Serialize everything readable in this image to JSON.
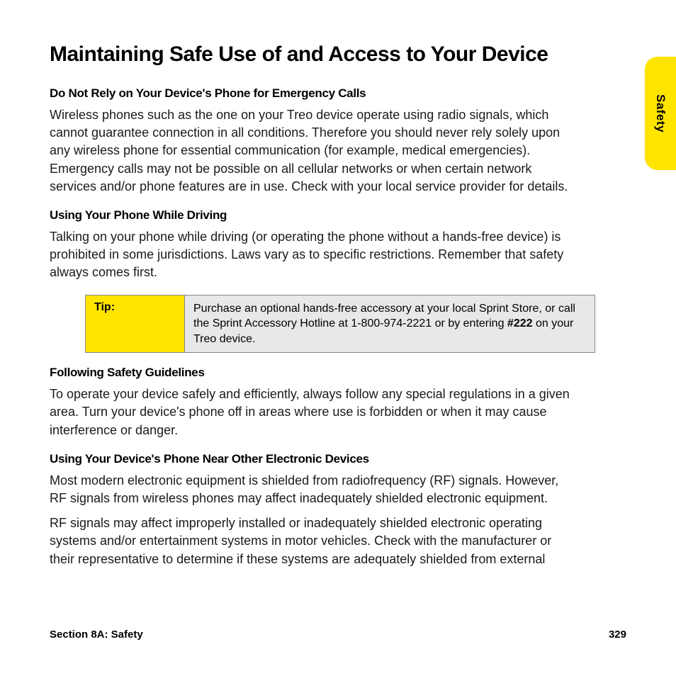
{
  "sideTab": "Safety",
  "title": "Maintaining Safe Use of and Access to Your Device",
  "sections": {
    "s1h": "Do Not Rely on Your Device's Phone for Emergency Calls",
    "s1p": "Wireless phones such as the one on your Treo device operate using radio signals, which cannot guarantee connection in all conditions. Therefore you should never rely solely upon any wireless phone for essential communication (for example, medical emergencies). Emergency calls may not be possible on all cellular networks or when certain network services and/or phone features are in use. Check with your local service provider for details.",
    "s2h": "Using Your Phone While Driving",
    "s2p": "Talking on your phone while driving (or operating the phone without a hands-free device) is prohibited in some jurisdictions. Laws vary as to specific restrictions. Remember that safety always comes first.",
    "s3h": "Following Safety Guidelines",
    "s3p": "To operate your device safely and efficiently, always follow any special regulations in a given area. Turn your device's phone off in areas where use is forbidden or when it may cause interference or danger.",
    "s4h": "Using Your Device's Phone Near Other Electronic Devices",
    "s4p1": "Most modern electronic equipment is shielded from radiofrequency (RF) signals. However, RF signals from wireless phones may affect inadequately shielded electronic equipment.",
    "s4p2": "RF signals may affect improperly installed or inadequately shielded electronic operating systems and/or entertainment systems in motor vehicles. Check with the manufacturer or their representative to determine if these systems are adequately shielded from external"
  },
  "tip": {
    "label": "Tip:",
    "text_before": "Purchase an optional hands-free accessory at your local Sprint Store, or call the  Sprint Accessory Hotline at 1-800-974-2221 or by entering ",
    "code": "#222",
    "text_after": " on your Treo device."
  },
  "footer": {
    "left": "Section 8A: Safety",
    "right": "329"
  }
}
